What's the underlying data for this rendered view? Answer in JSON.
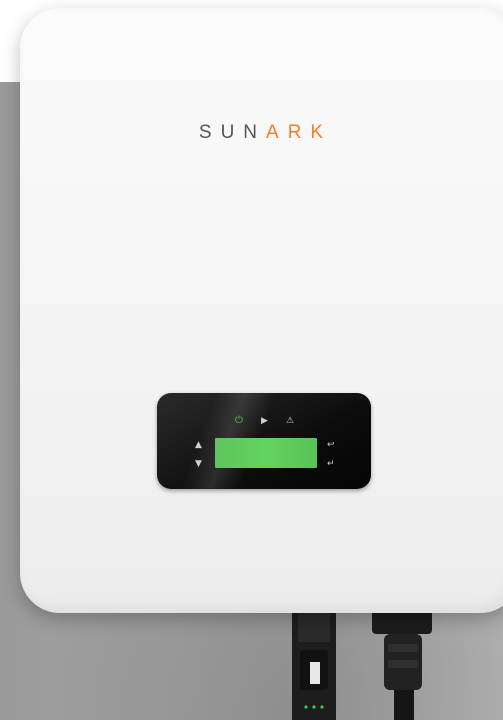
{
  "brand": {
    "prefix": "SUN",
    "accent": "ARK",
    "accent_color": "#f07f2c",
    "prefix_color": "#555555"
  },
  "control_panel": {
    "indicators": [
      {
        "name": "power-icon",
        "glyph": "⏻",
        "color": "#4bd64b"
      },
      {
        "name": "run-icon",
        "glyph": "▶",
        "color": "#cfcfcf"
      },
      {
        "name": "alarm-icon",
        "glyph": "⚠",
        "color": "#cfcfcf"
      }
    ],
    "lcd_color": "#63d35f",
    "keys": {
      "up": "▲",
      "down": "▼",
      "back": "↩",
      "enter": "↵"
    }
  },
  "colors": {
    "housing": "#f5f5f5",
    "backdrop": "#a7a7a7",
    "panel": "#0c0c0c"
  }
}
